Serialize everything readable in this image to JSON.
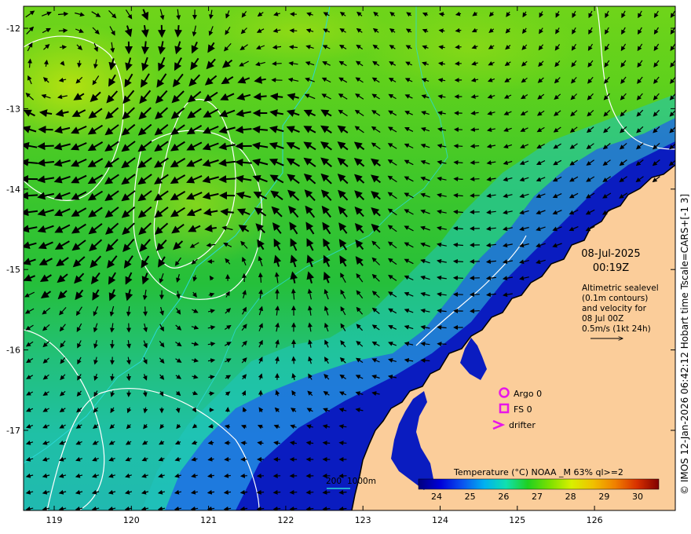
{
  "map": {
    "axes": {
      "x_ticks": [
        "119",
        "120",
        "121",
        "122",
        "123",
        "124",
        "125",
        "126"
      ],
      "y_ticks": [
        "-12",
        "-13",
        "-14",
        "-15",
        "-16",
        "-17"
      ]
    },
    "date": "08-Jul-2025",
    "time": "00:19Z",
    "info_lines": [
      "Altimetric sealevel",
      "(0.1m contours)",
      "and velocity for",
      "08 Jul 00Z",
      "0.5m/s (1kt 24h)"
    ],
    "legend": [
      {
        "symbol": "circle",
        "label": "Argo 0",
        "color": "#e815e8"
      },
      {
        "symbol": "square",
        "label": "FS 0",
        "color": "#e815e8"
      },
      {
        "symbol": "chevron",
        "label": "drifter",
        "color": "#e815e8"
      }
    ],
    "depth_legend": {
      "label_200": "200",
      "label_1000": "1000m",
      "color": "#2ad8d8"
    },
    "colorbar": {
      "title": "Temperature (°C) NOAA _M 63% ql>=2",
      "ticks": [
        "24",
        "25",
        "26",
        "27",
        "28",
        "29",
        "30"
      ],
      "colors": [
        "#00007f",
        "#0000d8",
        "#0a52f0",
        "#00b0f0",
        "#10e0b0",
        "#20d020",
        "#7be000",
        "#d8f000",
        "#f0c000",
        "#f08000",
        "#d83000",
        "#800000"
      ]
    },
    "credit": "© IMOS 12-Jan-2026 06:42:12 Hobart time Tscale=CARS+[-1 3]",
    "colors": {
      "land": "#fbcd9a",
      "contour": "#ffffff",
      "isobath": "#2ad8d8",
      "arrow": "#000000"
    }
  }
}
